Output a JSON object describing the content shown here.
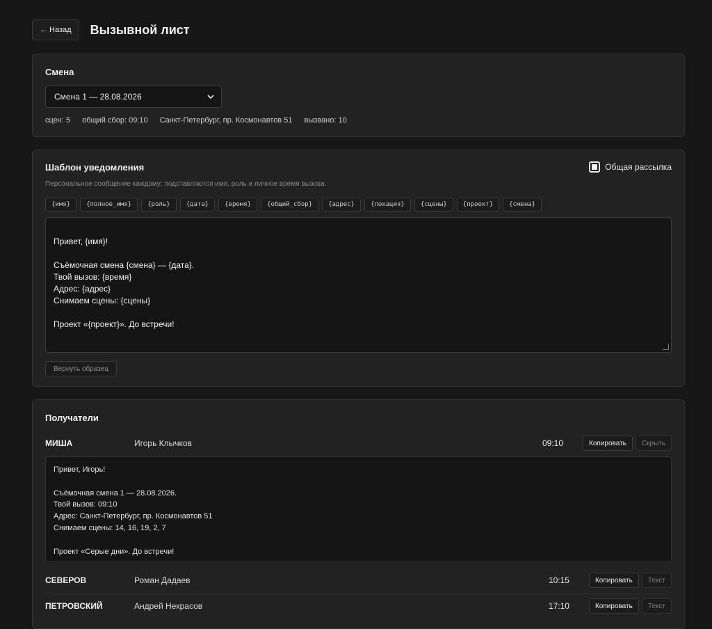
{
  "header": {
    "back_label": "← Назад",
    "title": "Вызывной лист"
  },
  "shift": {
    "title": "Смена",
    "selected": "Смена 1 — 28.08.2026",
    "stats": {
      "scenes": "сцен: 5",
      "gather": "общий сбор: 09:10",
      "address": "Санкт-Петербург, пр. Космонавтов 51",
      "called": "вызвано: 10"
    }
  },
  "template": {
    "title": "Шаблон уведомления",
    "broadcast_label": "Общая рассылка",
    "broadcast_checked": true,
    "hint": "Персональное сообщение каждому: подставляются имя, роль и личное время вызова.",
    "tokens": [
      "{имя}",
      "{полное_имя}",
      "{роль}",
      "{дата}",
      "{время}",
      "{общий_сбор}",
      "{адрес}",
      "{локация}",
      "{сцены}",
      "{проект}",
      "{смена}"
    ],
    "text": "Привет, {имя}!\n\nСъёмочная смена {смена} — {дата}.\nТвой вызов: {время}\nАдрес: {адрес}\nСнимаем сцены: {сцены}\n\nПроект «{проект}». До встречи!",
    "reset_label": "Вернуть образец"
  },
  "recipients": {
    "title": "Получатели",
    "items": [
      {
        "role": "МИША",
        "name": "Игорь Клычков",
        "time": "09:10",
        "copy_label": "Копировать",
        "toggle_label": "Скрыть",
        "preview": "Привет, Игорь!\n\nСъёмочная смена 1 — 28.08.2026.\nТвой вызов: 09:10\nАдрес: Санкт-Петербург, пр. Космонавтов 51\nСнимаем сцены: 14, 16, 19, 2, 7\n\nПроект «Серые дни». До встречи!"
      },
      {
        "role": "СЕВЕРОВ",
        "name": "Роман Дадаев",
        "time": "10:15",
        "copy_label": "Копировать",
        "toggle_label": "Текст"
      },
      {
        "role": "ПЕТРОВСКИЙ",
        "name": "Андрей Некрасов",
        "time": "17:10",
        "copy_label": "Копировать",
        "toggle_label": "Текст"
      }
    ]
  }
}
